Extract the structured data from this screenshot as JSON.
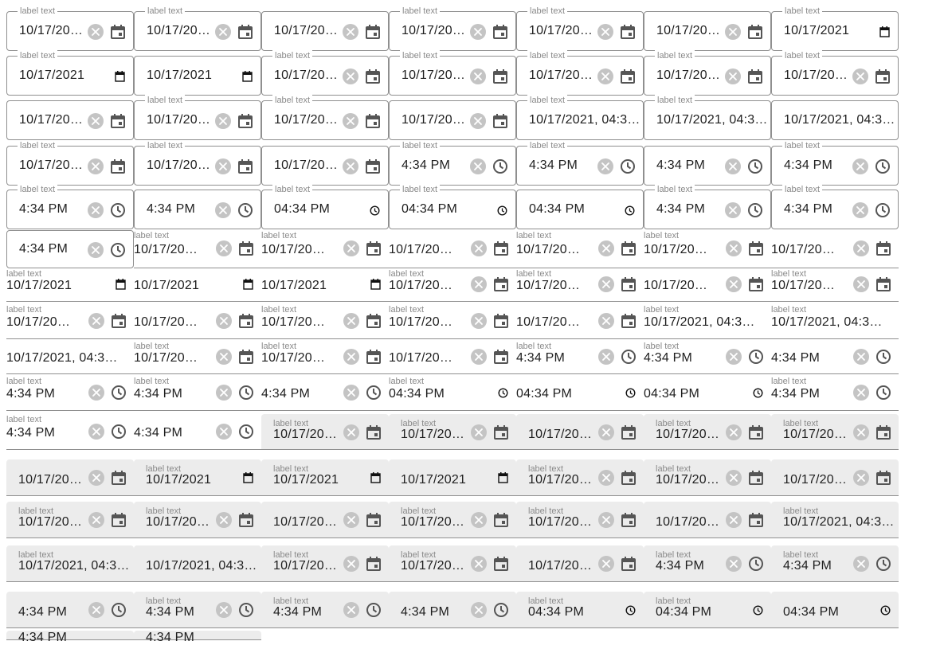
{
  "label": "label text",
  "values": {
    "date": "10/17/2021",
    "datetime": "10/17/2021, 04:34 PM",
    "time": "4:34 PM",
    "time_native": "04:34 PM"
  },
  "icons": {
    "clear": "close-icon",
    "calendar": "calendar-icon",
    "clock": "clock-icon"
  },
  "colors": {
    "filled_background": "#ececec",
    "border": "#8f8f8f",
    "label": "#8a8a8a",
    "clear_button": "#c4c4c4"
  }
}
